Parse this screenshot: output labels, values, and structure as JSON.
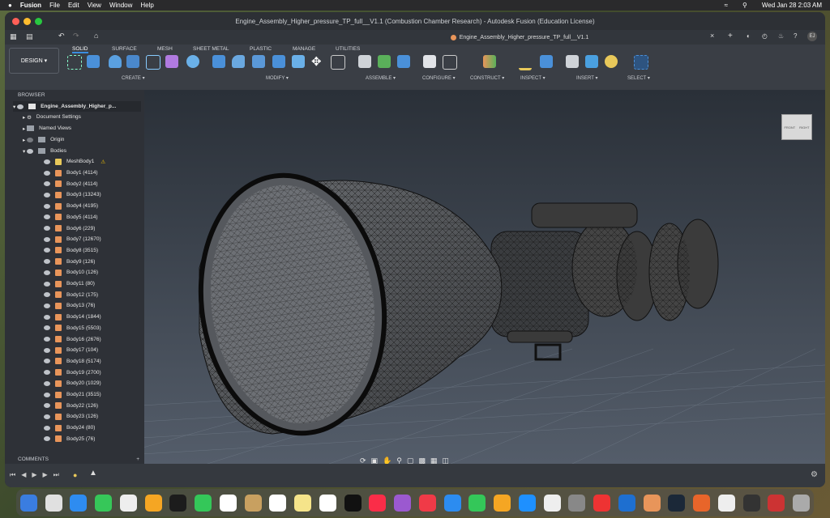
{
  "menubar": {
    "app": "Fusion",
    "items": [
      "File",
      "Edit",
      "View",
      "Window",
      "Help"
    ],
    "clock": "Wed Jan 28  2:03 AM"
  },
  "window": {
    "title": "Engine_Assembly_Higher_pressure_TP_full__V1.1 (Combustion Chamber Research) - Autodesk Fusion (Education License)",
    "doc_tab": "Engine_Assembly_Higher_pressure_TP_full__V1.1"
  },
  "toolbar": {
    "workspace": "DESIGN",
    "tabs": [
      "SOLID",
      "SURFACE",
      "MESH",
      "SHEET METAL",
      "PLASTIC",
      "MANAGE",
      "UTILITIES"
    ],
    "groups": [
      "CREATE",
      "MODIFY",
      "ASSEMBLE",
      "CONFIGURE",
      "CONSTRUCT",
      "INSPECT",
      "INSERT",
      "SELECT"
    ]
  },
  "browser": {
    "title": "BROWSER",
    "root": "Engine_Assembly_Higher_p...",
    "items": [
      "Document Settings",
      "Named Views",
      "Origin",
      "Bodies",
      "MeshBody1"
    ],
    "bodies": [
      "Body1 (4114)",
      "Body2 (4114)",
      "Body3 (13243)",
      "Body4 (4195)",
      "Body5 (4114)",
      "Body6 (229)",
      "Body7 (12670)",
      "Body8 (3515)",
      "Body9 (126)",
      "Body10 (126)",
      "Body11 (80)",
      "Body12 (175)",
      "Body13 (76)",
      "Body14 (1844)",
      "Body15 (5503)",
      "Body16 (2676)",
      "Body17 (104)",
      "Body18 (5174)",
      "Body19 (2700)",
      "Body20 (1029)",
      "Body21 (3515)",
      "Body22 (126)",
      "Body23 (126)",
      "Body24 (80)",
      "Body25 (76)"
    ]
  },
  "comments": {
    "title": "COMMENTS"
  },
  "viewcube": {
    "front": "FRONT",
    "right": "RIGHT"
  },
  "colors": {
    "accent": "#e8955a",
    "ribbon": "#3a3e45",
    "panel": "#2e3137"
  }
}
